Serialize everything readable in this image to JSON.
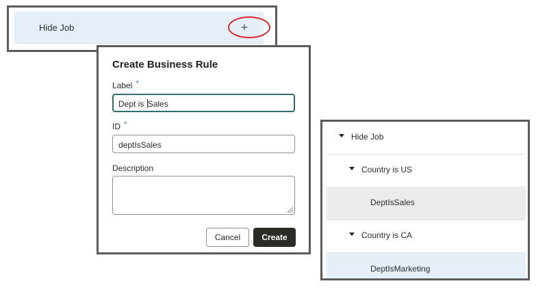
{
  "panel_top": {
    "row_label": "Hide Job",
    "add_glyph": "+"
  },
  "dialog": {
    "title": "Create Business Rule",
    "label_field": {
      "label": "Label",
      "required_mark": "*",
      "value_before_caret": "Dept is ",
      "value_after_caret": "Sales"
    },
    "id_field": {
      "label": "ID",
      "required_mark": "*",
      "value": "deptIsSales"
    },
    "description_field": {
      "label": "Description",
      "value": ""
    },
    "cancel_label": "Cancel",
    "create_label": "Create"
  },
  "tree": {
    "items": [
      {
        "label": "Hide Job",
        "level": 0,
        "expanded": true,
        "state": "normal"
      },
      {
        "label": "Country is US",
        "level": 1,
        "expanded": true,
        "state": "normal"
      },
      {
        "label": "DeptIsSales",
        "level": 2,
        "state": "hover"
      },
      {
        "label": "Country is CA",
        "level": 1,
        "expanded": true,
        "state": "normal"
      },
      {
        "label": "DeptIsMarketing",
        "level": 2,
        "state": "selected"
      }
    ]
  },
  "colors": {
    "highlight_ring": "#d8262c",
    "selected_row": "#e4eff7",
    "focus_border": "#2d6e6a",
    "primary_button": "#2e2a26",
    "required_asterisk": "#2a7ab0"
  },
  "icons": {
    "add": "plus-icon",
    "expand": "caret-down-icon"
  }
}
